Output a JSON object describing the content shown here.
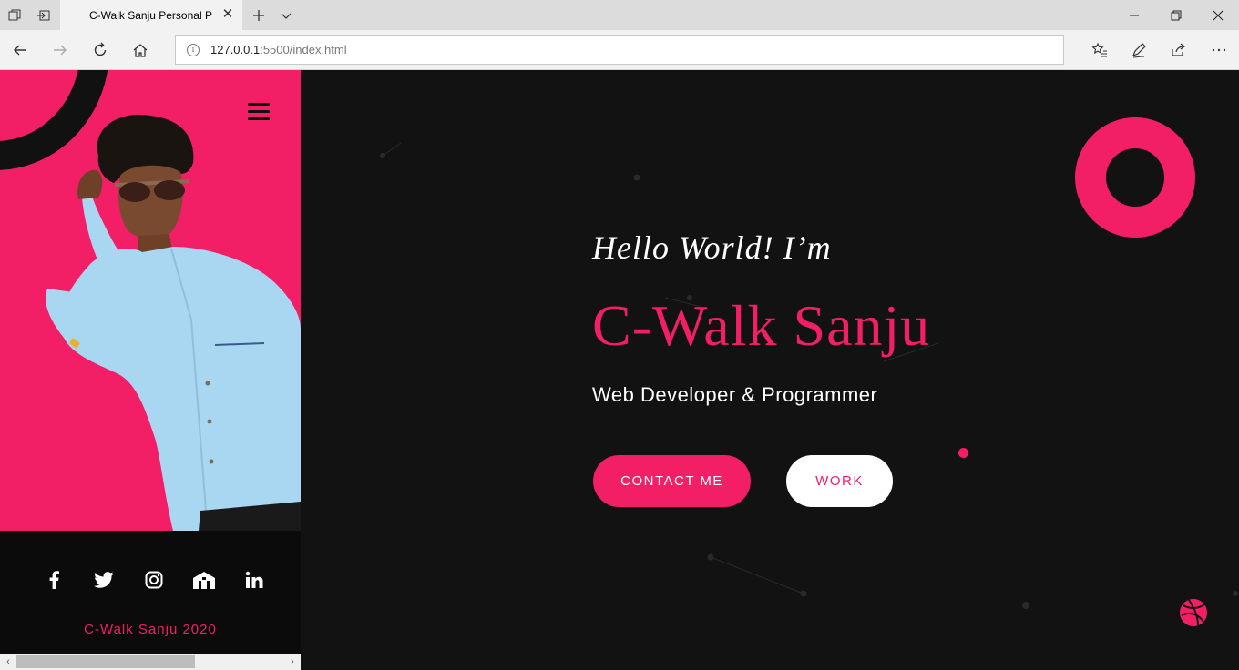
{
  "browser": {
    "tab_title": "C-Walk Sanju Personal P",
    "url_host": "127.0.0.1",
    "url_rest": ":5500/index.html"
  },
  "sidebar": {
    "social_icons": [
      "facebook-icon",
      "twitter-icon",
      "instagram-icon",
      "house-icon",
      "linkedin-icon"
    ],
    "copyright": "C-Walk Sanju 2020"
  },
  "hero": {
    "greeting": "Hello World! I’m",
    "name": "C-Walk Sanju",
    "role": "Web Developer & Programmer",
    "contact_label": "CONTACT ME",
    "work_label": "WORK"
  },
  "colors": {
    "accent": "#f21f67",
    "dark": "#121212",
    "sidebar_bottom": "#0b0b0b"
  }
}
